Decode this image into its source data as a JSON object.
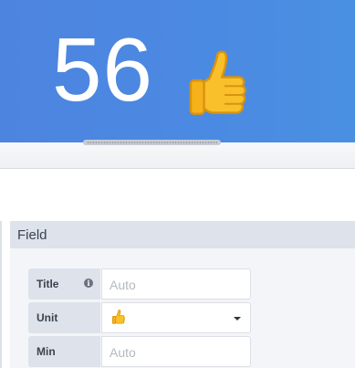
{
  "stat": {
    "value": "56",
    "emoji_icon": "thumbs-up-icon",
    "background": "#4a8be1"
  },
  "field_section": {
    "title": "Field",
    "rows": [
      {
        "label": "Title",
        "placeholder": "Auto",
        "info_icon": "info-icon"
      },
      {
        "label": "Unit",
        "value_icon": "thumbs-up-icon",
        "control": "dropdown"
      },
      {
        "label": "Min",
        "placeholder": "Auto"
      }
    ]
  }
}
